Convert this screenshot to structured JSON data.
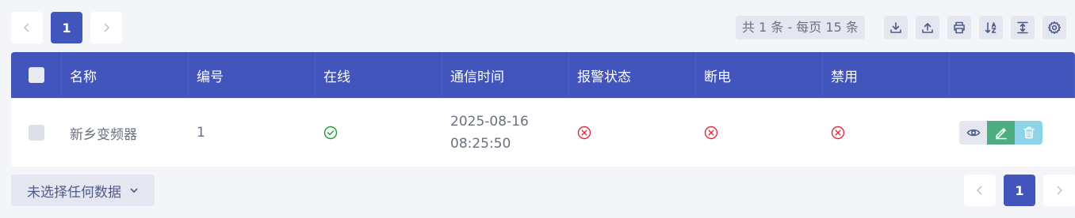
{
  "pagination": {
    "prev_icon": "chevron-left-icon",
    "next_icon": "chevron-right-icon",
    "current_page": "1"
  },
  "toolbar": {
    "summary": "共 1 条 - 每页 15 条",
    "icons": [
      "download-icon",
      "upload-icon",
      "print-icon",
      "sort-az-icon",
      "column-height-icon",
      "gear-icon"
    ]
  },
  "table": {
    "headers": [
      "名称",
      "编号",
      "在线",
      "通信时间",
      "报警状态",
      "断电",
      "禁用"
    ],
    "rows": [
      {
        "name": "新乡变频器",
        "number": "1",
        "online": "check-circle-icon",
        "comm_time": "2025-08-16\n08:25:50",
        "alarm": "x-circle-icon",
        "power_off": "x-circle-icon",
        "disabled": "x-circle-icon",
        "actions": [
          "eye-icon",
          "pencil-icon",
          "trash-icon"
        ]
      }
    ]
  },
  "selection": {
    "label": "未选择任何数据"
  },
  "colors": {
    "primary": "#4255bd",
    "success": "#1a9b3a",
    "danger": "#e0283b",
    "edit": "#4cae80",
    "delete": "#8dd4e8"
  }
}
